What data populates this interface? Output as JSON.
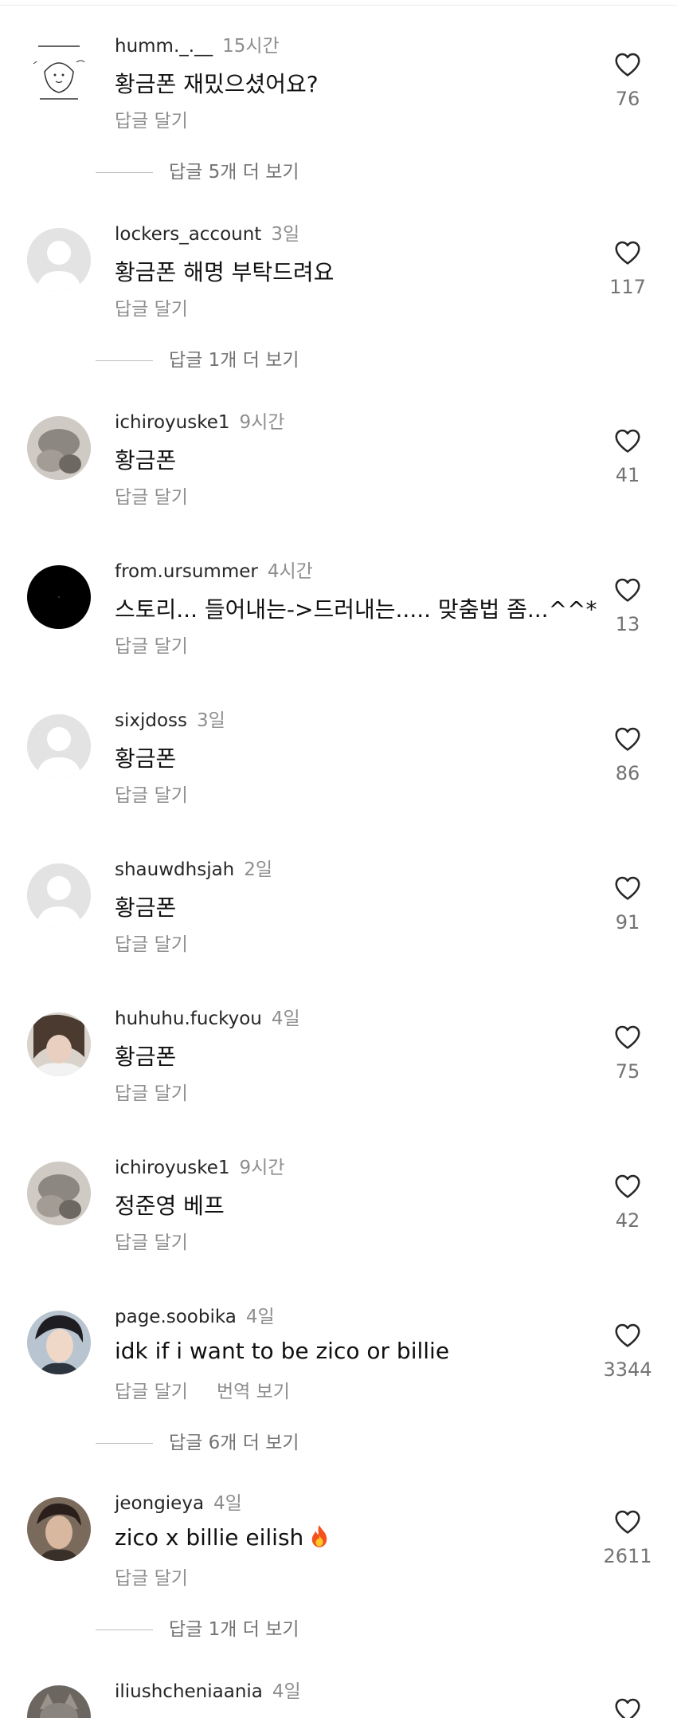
{
  "comments": [
    {
      "username": "humm._.__",
      "time": "15시간",
      "text": "황금폰 재밌으셨어요?",
      "reply_label": "답글 달기",
      "likes": "76",
      "more_replies": "답글 5개 더 보기",
      "avatar_kind": "sketch"
    },
    {
      "username": "lockers_account",
      "time": "3일",
      "text": "황금폰 해명 부탁드려요",
      "reply_label": "답글 달기",
      "likes": "117",
      "more_replies": "답글 1개 더 보기",
      "avatar_kind": "default"
    },
    {
      "username": "ichiroyuske1",
      "time": "9시간",
      "text": "황금폰",
      "reply_label": "답글 달기",
      "likes": "41",
      "avatar_kind": "photo"
    },
    {
      "username": "from.ursummer",
      "time": "4시간",
      "text": "스토리... 들어내는->드러내는..... 맞춤법 좀...^^*",
      "reply_label": "답글 달기",
      "likes": "13",
      "avatar_kind": "black"
    },
    {
      "username": "sixjdoss",
      "time": "3일",
      "text": "황금폰",
      "reply_label": "답글 달기",
      "likes": "86",
      "avatar_kind": "default"
    },
    {
      "username": "shauwdhsjah",
      "time": "2일",
      "text": "황금폰",
      "reply_label": "답글 달기",
      "likes": "91",
      "avatar_kind": "default"
    },
    {
      "username": "huhuhu.fuckyou",
      "time": "4일",
      "text": "황금폰",
      "reply_label": "답글 달기",
      "likes": "75",
      "avatar_kind": "photo"
    },
    {
      "username": "ichiroyuske1",
      "time": "9시간",
      "text": "정준영 베프",
      "reply_label": "답글 달기",
      "likes": "42",
      "avatar_kind": "photo"
    },
    {
      "username": "page.soobika",
      "time": "4일",
      "text": "idk if i want to be zico or billie",
      "reply_label": "답글 달기",
      "translate_label": "번역 보기",
      "likes": "3344",
      "more_replies": "답글 6개 더 보기",
      "avatar_kind": "photo"
    },
    {
      "username": "jeongieya",
      "time": "4일",
      "text": "zico x billie eilish",
      "emoji": "fire-emoji",
      "reply_label": "답글 달기",
      "likes": "2611",
      "more_replies": "답글 1개 더 보기",
      "avatar_kind": "photo"
    },
    {
      "username": "iliushcheniaania",
      "time": "4일",
      "avatar_kind": "photo"
    }
  ],
  "icons": {
    "like": "heart-outline-icon"
  },
  "colors": {
    "text": "#262626",
    "secondary": "#8e8e8e",
    "avatar_default": "#e3e3e3"
  }
}
